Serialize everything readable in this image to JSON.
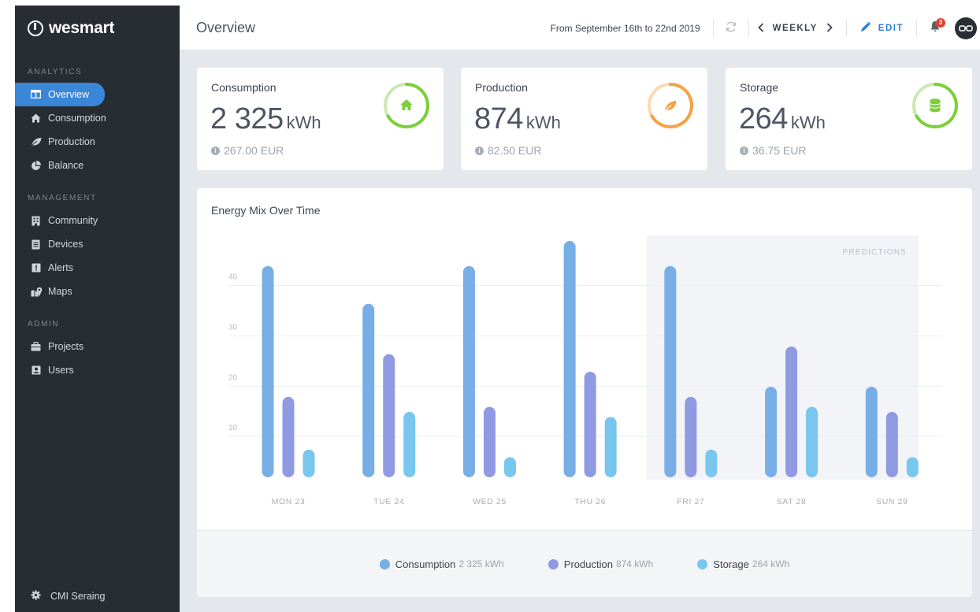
{
  "brand": {
    "name": "wesmart"
  },
  "sidebar": {
    "sections": [
      {
        "label": "ANALYTICS",
        "items": [
          {
            "label": "Overview",
            "icon": "columns-icon",
            "active": true
          },
          {
            "label": "Consumption",
            "icon": "home-icon"
          },
          {
            "label": "Production",
            "icon": "leaf-icon"
          },
          {
            "label": "Balance",
            "icon": "pie-chart-icon"
          }
        ]
      },
      {
        "label": "MANAGEMENT",
        "items": [
          {
            "label": "Community",
            "icon": "building-icon"
          },
          {
            "label": "Devices",
            "icon": "device-icon"
          },
          {
            "label": "Alerts",
            "icon": "alert-icon"
          },
          {
            "label": "Maps",
            "icon": "map-icon"
          }
        ]
      },
      {
        "label": "ADMIN",
        "items": [
          {
            "label": "Projects",
            "icon": "briefcase-icon"
          },
          {
            "label": "Users",
            "icon": "user-card-icon"
          }
        ]
      }
    ],
    "footer": {
      "label": "CMI Seraing",
      "icon": "gear-icon"
    }
  },
  "header": {
    "title": "Overview",
    "date_range": "From September 16th to 22nd 2019",
    "period": "WEEKLY",
    "edit_label": "EDIT",
    "notifications_count": "3",
    "avatar_initials": "бә"
  },
  "kpis": [
    {
      "title": "Consumption",
      "value": "2 325",
      "unit": "kWh",
      "cost": "267.00 EUR",
      "color": "#7ccf3a",
      "icon": "home-icon"
    },
    {
      "title": "Production",
      "value": "874",
      "unit": "kWh",
      "cost": "82.50 EUR",
      "color": "#f5a244",
      "icon": "leaf-icon"
    },
    {
      "title": "Storage",
      "value": "264",
      "unit": "kWh",
      "cost": "36.75 EUR",
      "color": "#7ccf3a",
      "icon": "database-icon"
    }
  ],
  "chart": {
    "title": "Energy Mix Over Time",
    "predictions_label": "PREDICTIONS",
    "legend": [
      {
        "name": "Consumption",
        "value": "2 325 kWh",
        "color": "#78aee6"
      },
      {
        "name": "Production",
        "value": "874 kWh",
        "color": "#8f9ae3"
      },
      {
        "name": "Storage",
        "value": "264 kWh",
        "color": "#79c6ee"
      }
    ]
  },
  "chart_data": {
    "type": "bar",
    "title": "Energy Mix Over Time",
    "categories": [
      "MON 23",
      "TUE 24",
      "WED 25",
      "THU 26",
      "FRI 27",
      "SAT 28",
      "SUN 29"
    ],
    "yticks": [
      10,
      20,
      30,
      40
    ],
    "ylim": [
      0,
      47
    ],
    "grid": true,
    "prediction_categories": [
      "FRI 27",
      "SAT 28",
      "SUN 29"
    ],
    "series": [
      {
        "name": "Consumption",
        "color": "#78aee6",
        "values": [
          42,
          34.5,
          42,
          47,
          42,
          18,
          18
        ]
      },
      {
        "name": "Production",
        "color": "#8f9ae3",
        "values": [
          16,
          24.5,
          14,
          21,
          16,
          26,
          13
        ]
      },
      {
        "name": "Storage",
        "color": "#79c6ee",
        "values": [
          5.5,
          13,
          4,
          12,
          5.5,
          14,
          4
        ]
      }
    ]
  }
}
